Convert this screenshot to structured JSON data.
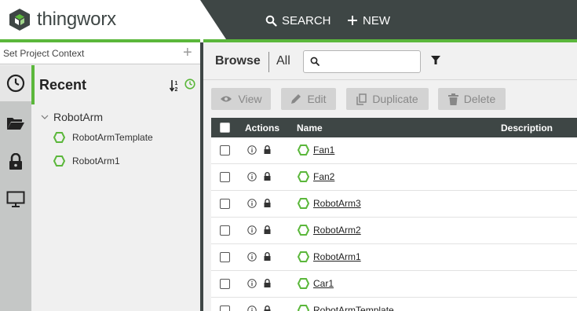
{
  "header": {
    "logo_text": "thingworx",
    "search_label": "SEARCH",
    "new_label": "NEW",
    "brand_green": "#5bb73b",
    "bar_color": "#3e4645"
  },
  "left": {
    "project_context_placeholder": "Set Project Context",
    "rail_icons": [
      "clock-icon",
      "folder-icon",
      "lock-icon",
      "monitor-icon"
    ],
    "recent_title": "Recent",
    "tree": {
      "root": "RobotArm",
      "children": [
        "RobotArmTemplate",
        "RobotArm1"
      ]
    }
  },
  "browse": {
    "title": "Browse",
    "filter": "All",
    "search_value": ""
  },
  "actions": {
    "view": "View",
    "edit": "Edit",
    "duplicate": "Duplicate",
    "delete": "Delete"
  },
  "grid": {
    "columns": [
      "Actions",
      "Name",
      "Description"
    ],
    "rows": [
      {
        "name": "Fan1"
      },
      {
        "name": "Fan2"
      },
      {
        "name": "RobotArm3"
      },
      {
        "name": "RobotArm2"
      },
      {
        "name": "RobotArm1"
      },
      {
        "name": "Car1"
      },
      {
        "name": "RobotArmTemplate"
      }
    ]
  }
}
